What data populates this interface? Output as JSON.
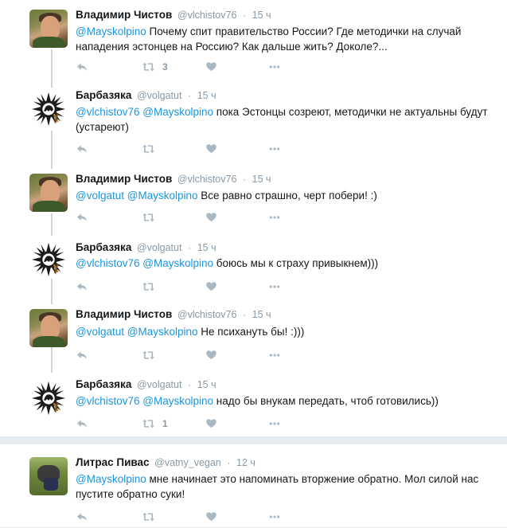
{
  "tweets": [
    {
      "name": "Владимир Чистов",
      "handle": "@vlchistov76",
      "time": "15 ч",
      "mentions": [
        "@Mayskolpino"
      ],
      "text": "Почему спит правительство России? Где методички на случай нападения эстонцев на Россию? Как дальше жить? Доколе?...",
      "retweets": "3",
      "likes": ""
    },
    {
      "name": "Барбазяка",
      "handle": "@volgatut",
      "time": "15 ч",
      "mentions": [
        "@vlchistov76",
        "@Mayskolpino"
      ],
      "text": "пока Эстонцы созреют, методички не актуальны будут (устареют)",
      "retweets": "",
      "likes": ""
    },
    {
      "name": "Владимир Чистов",
      "handle": "@vlchistov76",
      "time": "15 ч",
      "mentions": [
        "@volgatut",
        "@Mayskolpino"
      ],
      "text": "Все равно страшно, черт побери! :)",
      "retweets": "",
      "likes": ""
    },
    {
      "name": "Барбазяка",
      "handle": "@volgatut",
      "time": "15 ч",
      "mentions": [
        "@vlchistov76",
        "@Mayskolpino"
      ],
      "text": "боюсь мы к страху привыкнем)))",
      "retweets": "",
      "likes": ""
    },
    {
      "name": "Владимир Чистов",
      "handle": "@vlchistov76",
      "time": "15 ч",
      "mentions": [
        "@volgatut",
        "@Mayskolpino"
      ],
      "text": "Не психануть бы! :)))",
      "retweets": "",
      "likes": ""
    },
    {
      "name": "Барбазяка",
      "handle": "@volgatut",
      "time": "15 ч",
      "mentions": [
        "@vlchistov76",
        "@Mayskolpino"
      ],
      "text": "надо бы внукам передать, чтоб готовились))",
      "retweets": "1",
      "likes": ""
    },
    {
      "name": "Литрас Пивас",
      "handle": "@vatny_vegan",
      "time": "12 ч",
      "mentions": [
        "@Mayskolpino"
      ],
      "text": "мне начинает это напоминать вторжение обратно. Мол силой нас пустите обратно суки!",
      "retweets": "",
      "likes": ""
    }
  ],
  "dot": "·",
  "icons": {
    "reply": "reply-icon",
    "retweet": "retweet-icon",
    "like": "heart-icon",
    "more": "more-icon"
  },
  "colors": {
    "link": "#1b95e0",
    "muted": "#8899a6",
    "icon": "#aab8c2",
    "thread_line": "#ccd6dd"
  }
}
